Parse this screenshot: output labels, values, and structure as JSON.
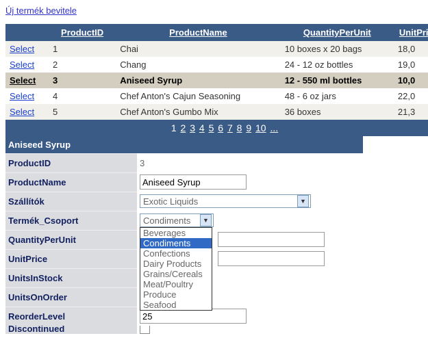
{
  "addLink": "Új termék bevitele",
  "grid": {
    "headers": [
      "",
      "ProductID",
      "ProductName",
      "QuantityPerUnit",
      "UnitPrice"
    ],
    "selectLabel": "Select",
    "rows": [
      {
        "id": "1",
        "name": "Chai",
        "qpu": "10 boxes x 20 bags",
        "price": "18,0"
      },
      {
        "id": "2",
        "name": "Chang",
        "qpu": "24 - 12 oz bottles",
        "price": "19,0"
      },
      {
        "id": "3",
        "name": "Aniseed Syrup",
        "qpu": "12 - 550 ml bottles",
        "price": "10,0"
      },
      {
        "id": "4",
        "name": "Chef Anton's Cajun Seasoning",
        "qpu": "48 - 6 oz jars",
        "price": "22,0"
      },
      {
        "id": "5",
        "name": "Chef Anton's Gumbo Mix",
        "qpu": "36 boxes",
        "price": "21,3"
      }
    ],
    "selectedIndex": 2,
    "pager": [
      "1",
      "2",
      "3",
      "4",
      "5",
      "6",
      "7",
      "8",
      "9",
      "10",
      "..."
    ]
  },
  "details": {
    "title": "Aniseed Syrup",
    "labels": {
      "productId": "ProductID",
      "productName": "ProductName",
      "supplier": "Szállítók",
      "category": "Termék_Csoport",
      "qpu": "QuantityPerUnit",
      "unitPrice": "UnitPrice",
      "unitsInStock": "UnitsInStock",
      "unitsOnOrder": "UnitsOnOrder",
      "reorder": "ReorderLevel",
      "discontinued": "Discontinued"
    },
    "values": {
      "productId": "3",
      "productName": "Aniseed Syrup",
      "supplier": "Exotic Liquids",
      "categorySelected": "Condiments",
      "categoryOptions": [
        "Beverages",
        "Condiments",
        "Confections",
        "Dairy Products",
        "Grains/Cereals",
        "Meat/Poultry",
        "Produce",
        "Seafood"
      ],
      "reorder": "25"
    }
  }
}
